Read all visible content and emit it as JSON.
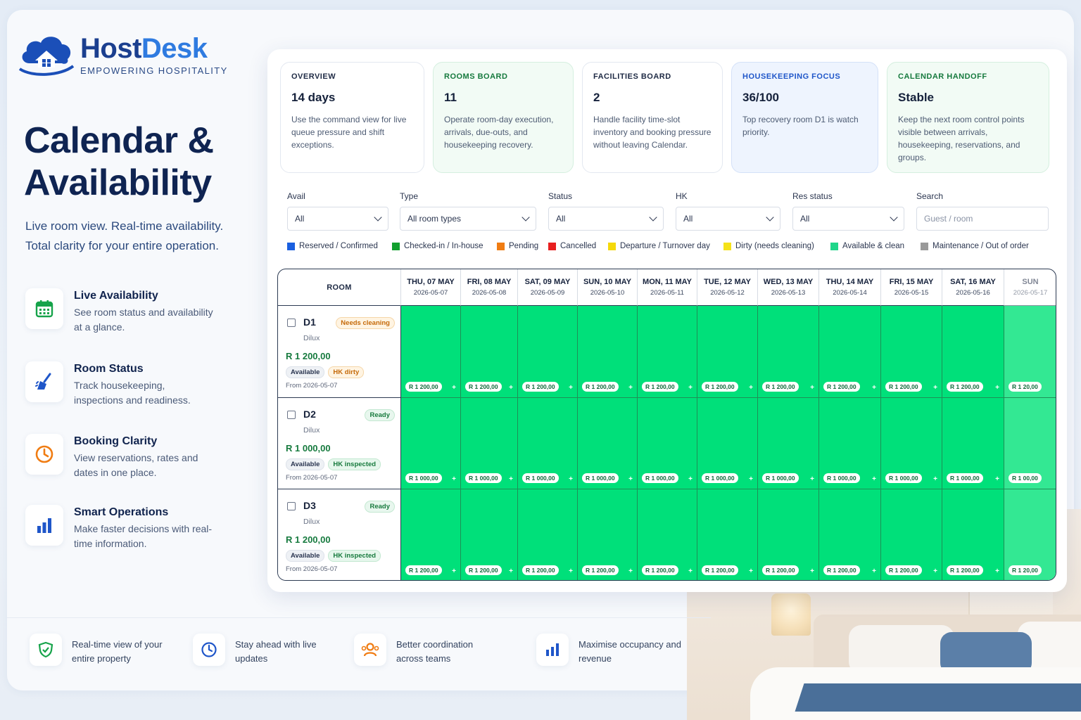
{
  "brand": {
    "name_part1": "Host",
    "name_part2": "Desk",
    "tagline": "EMPOWERING HOSPITALITY"
  },
  "hero": {
    "title_line1": "Calendar &",
    "title_line2": "Availability",
    "subtitle": "Live room view. Real-time availability. Total clarity for your entire operation."
  },
  "features": [
    {
      "icon": "calendar-icon",
      "title": "Live Availability",
      "desc": "See room status and availability at a glance."
    },
    {
      "icon": "broom-icon",
      "title": "Room Status",
      "desc": "Track housekeeping, inspections and readiness."
    },
    {
      "icon": "clock-icon",
      "title": "Booking Clarity",
      "desc": "View reservations, rates and dates in one place."
    },
    {
      "icon": "bar-chart-icon",
      "title": "Smart Operations",
      "desc": "Make faster decisions with real-time information."
    }
  ],
  "benefits": [
    {
      "icon": "shield-check-icon",
      "text": "Real-time view of your entire property"
    },
    {
      "icon": "clock-icon",
      "text": "Stay ahead with live updates"
    },
    {
      "icon": "team-icon",
      "text": "Better coordination across teams"
    },
    {
      "icon": "bar-chart-icon",
      "text": "Maximise occupancy and revenue"
    }
  ],
  "kpis": [
    {
      "label": "OVERVIEW",
      "value": "14 days",
      "desc": "Use the command view for live queue pressure and shift exceptions."
    },
    {
      "label": "ROOMS BOARD",
      "value": "11",
      "desc": "Operate room-day execution, arrivals, due-outs, and housekeeping recovery."
    },
    {
      "label": "FACILITIES BOARD",
      "value": "2",
      "desc": "Handle facility time-slot inventory and booking pressure without leaving Calendar."
    },
    {
      "label": "HOUSEKEEPING FOCUS",
      "value": "36/100",
      "desc": "Top recovery room D1 is watch priority."
    },
    {
      "label": "CALENDAR HANDOFF",
      "value": "Stable",
      "desc": "Keep the next room control points visible between arrivals, housekeeping, reservations, and groups."
    }
  ],
  "filters": [
    {
      "label": "Avail",
      "value": "All"
    },
    {
      "label": "Type",
      "value": "All room types"
    },
    {
      "label": "Status",
      "value": "All"
    },
    {
      "label": "HK",
      "value": "All"
    },
    {
      "label": "Res status",
      "value": "All"
    }
  ],
  "search": {
    "label": "Search",
    "placeholder": "Guest / room"
  },
  "legend": [
    {
      "label": "Reserved / Confirmed",
      "color": "#1a5fe0"
    },
    {
      "label": "Checked-in / In-house",
      "color": "#12a02f"
    },
    {
      "label": "Pending",
      "color": "#f07c12"
    },
    {
      "label": "Cancelled",
      "color": "#e81f1f"
    },
    {
      "label": "Departure / Turnover day",
      "color": "#f5d90a"
    },
    {
      "label": "Dirty (needs cleaning)",
      "color": "#f5e21a"
    },
    {
      "label": "Available & clean",
      "color": "#1fd68a"
    },
    {
      "label": "Maintenance / Out of order",
      "color": "#9a9a9a"
    }
  ],
  "grid": {
    "room_header": "ROOM",
    "days": [
      {
        "day": "THU, 07 MAY",
        "date": "2026-05-07"
      },
      {
        "day": "FRI, 08 MAY",
        "date": "2026-05-08"
      },
      {
        "day": "SAT, 09 MAY",
        "date": "2026-05-09"
      },
      {
        "day": "SUN, 10 MAY",
        "date": "2026-05-10"
      },
      {
        "day": "MON, 11 MAY",
        "date": "2026-05-11"
      },
      {
        "day": "TUE, 12 MAY",
        "date": "2026-05-12"
      },
      {
        "day": "WED, 13 MAY",
        "date": "2026-05-13"
      },
      {
        "day": "THU, 14 MAY",
        "date": "2026-05-14"
      },
      {
        "day": "FRI, 15 MAY",
        "date": "2026-05-15"
      },
      {
        "day": "SAT, 16 MAY",
        "date": "2026-05-16"
      },
      {
        "day": "SUN",
        "date": "2026-05-17"
      }
    ],
    "rooms": [
      {
        "name": "D1",
        "badge": "Needs cleaning",
        "badge_type": "warn",
        "type": "Dilux",
        "price": "R 1 200,00",
        "tag1": "Available",
        "tag2": "HK dirty",
        "tag2_type": "dirty",
        "from": "From 2026-05-07",
        "rates": [
          "R 1 200,00",
          "R 1 200,00",
          "R 1 200,00",
          "R 1 200,00",
          "R 1 200,00",
          "R 1 200,00",
          "R 1 200,00",
          "R 1 200,00",
          "R 1 200,00",
          "R 1 200,00",
          "R 1 20,00"
        ]
      },
      {
        "name": "D2",
        "badge": "Ready",
        "badge_type": "ok",
        "type": "Dilux",
        "price": "R 1 000,00",
        "tag1": "Available",
        "tag2": "HK inspected",
        "tag2_type": "insp",
        "from": "From 2026-05-07",
        "rates": [
          "R 1 000,00",
          "R 1 000,00",
          "R 1 000,00",
          "R 1 000,00",
          "R 1 000,00",
          "R 1 000,00",
          "R 1 000,00",
          "R 1 000,00",
          "R 1 000,00",
          "R 1 000,00",
          "R 1 00,00"
        ]
      },
      {
        "name": "D3",
        "badge": "Ready",
        "badge_type": "ok",
        "type": "Dilux",
        "price": "R 1 200,00",
        "tag1": "Available",
        "tag2": "HK inspected",
        "tag2_type": "insp",
        "from": "From 2026-05-07",
        "rates": [
          "R 1 200,00",
          "R 1 200,00",
          "R 1 200,00",
          "R 1 200,00",
          "R 1 200,00",
          "R 1 200,00",
          "R 1 200,00",
          "R 1 200,00",
          "R 1 200,00",
          "R 1 200,00",
          "R 1 20,00"
        ]
      }
    ],
    "cell_color": "#00e07a",
    "add_symbol": "+"
  }
}
